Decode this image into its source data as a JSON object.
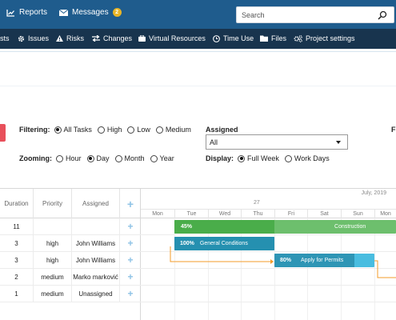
{
  "topbar": {
    "reports_label": "Reports",
    "messages_label": "Messages",
    "messages_count": "2",
    "search_placeholder": "Search"
  },
  "nav": {
    "items": [
      {
        "label": "sts",
        "icon": "none"
      },
      {
        "label": "Issues",
        "icon": "gear-icon"
      },
      {
        "label": "Risks",
        "icon": "warning-icon"
      },
      {
        "label": "Changes",
        "icon": "exchange-icon"
      },
      {
        "label": "Virtual Resources",
        "icon": "briefcase-icon"
      },
      {
        "label": "Time Use",
        "icon": "clock-icon"
      },
      {
        "label": "Files",
        "icon": "folder-icon"
      },
      {
        "label": "Project settings",
        "icon": "cogs-icon"
      }
    ]
  },
  "filters": {
    "filtering_label": "Filtering:",
    "filtering_options": [
      "All Tasks",
      "High",
      "Low",
      "Medium"
    ],
    "filtering_selected": "All Tasks",
    "zooming_label": "Zooming:",
    "zooming_options": [
      "Hour",
      "Day",
      "Month",
      "Year"
    ],
    "zooming_selected": "Day",
    "assigned_label": "Assigned",
    "assigned_value": "All",
    "display_label": "Display:",
    "display_options": [
      "Full Week",
      "Work Days"
    ],
    "display_selected": "Full Week",
    "cut_label": "F"
  },
  "grid": {
    "headers": {
      "duration": "Duration",
      "priority": "Priority",
      "assigned": "Assigned",
      "add": "+"
    },
    "rows": [
      {
        "duration": "11",
        "priority": "",
        "assigned": ""
      },
      {
        "duration": "3",
        "priority": "high",
        "assigned": "John Williams"
      },
      {
        "duration": "3",
        "priority": "high",
        "assigned": "John Williams"
      },
      {
        "duration": "2",
        "priority": "medium",
        "assigned": "Marko marković"
      },
      {
        "duration": "1",
        "priority": "medium",
        "assigned": "Unassigned"
      }
    ]
  },
  "chart": {
    "month_label": "July, 2019",
    "week_label": "27",
    "days": [
      "Mon",
      "Tue",
      "Wed",
      "Thu",
      "Fri",
      "Sat",
      "Sun",
      "Mon"
    ],
    "bars": [
      {
        "progress_label": "45%",
        "name": "Construction",
        "progress": 0.45,
        "color": "#6dbf6d",
        "progress_color": "#4aad4a"
      },
      {
        "progress_label": "100%",
        "name": "General Conditions",
        "progress": 1.0,
        "color": "#2e95b5",
        "progress_color": "#2590b0"
      },
      {
        "progress_label": "80%",
        "name": "Apply for Permits",
        "progress": 0.8,
        "color": "#49bde0",
        "progress_color": "#2e95b5"
      }
    ],
    "link_color": "#f39b2a"
  }
}
